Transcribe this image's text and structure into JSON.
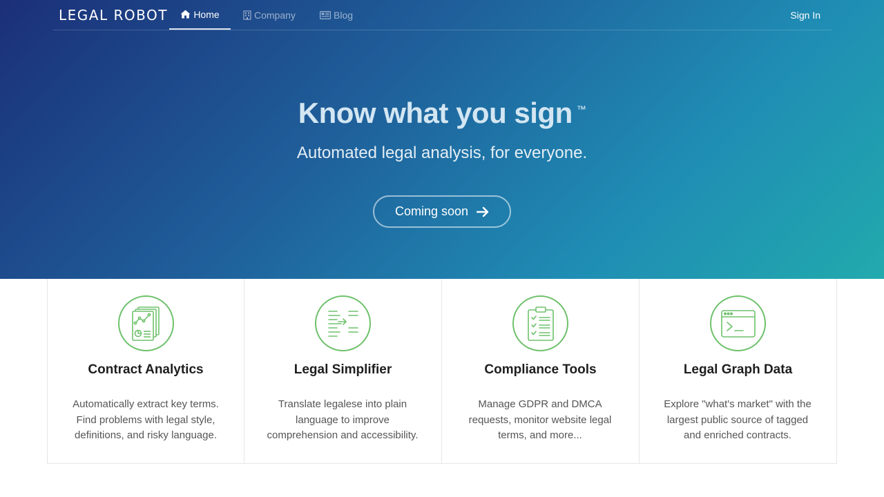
{
  "nav": {
    "logo": "LEGAL ROBOT",
    "items": [
      {
        "label": "Home",
        "icon": "home-icon",
        "active": true
      },
      {
        "label": "Company",
        "icon": "building-icon",
        "active": false
      },
      {
        "label": "Blog",
        "icon": "newspaper-icon",
        "active": false
      }
    ],
    "sign_in": "Sign In"
  },
  "hero": {
    "headline": "Know what you sign",
    "trademark": "™",
    "subheadline": "Automated legal analysis, for everyone.",
    "cta_label": "Coming soon"
  },
  "features": [
    {
      "icon": "contract-analytics-icon",
      "title": "Contract Analytics",
      "description": "Automatically extract key terms. Find problems with legal style, definitions, and risky language."
    },
    {
      "icon": "legal-simplifier-icon",
      "title": "Legal Simplifier",
      "description": "Translate legalese into plain language to improve comprehension and accessibility."
    },
    {
      "icon": "clipboard-checklist-icon",
      "title": "Compliance Tools",
      "description": "Manage GDPR and DMCA requests, monitor website legal terms, and more..."
    },
    {
      "icon": "terminal-window-icon",
      "title": "Legal Graph Data",
      "description": "Explore \"what's market\" with the largest public source of tagged and enriched contracts."
    }
  ],
  "colors": {
    "icon_green": "#6ec16b",
    "hero_gradient_start": "#1b2f78",
    "hero_gradient_end": "#22aaad"
  }
}
